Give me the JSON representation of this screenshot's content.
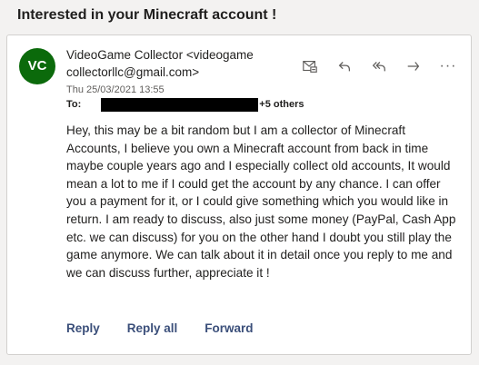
{
  "subject": "Interested in your Minecraft account !",
  "message": {
    "avatar_initials": "VC",
    "avatar_color": "#0b6a0b",
    "sender": "VideoGame Collector <videogame collectorllc@gmail.com>",
    "date": "Thu 25/03/2021 13:55",
    "to_label": "To:",
    "to_others": "+5 others",
    "body": "Hey, this may be a bit random but I am a collector of Minecraft Accounts, I believe you own a Minecraft account from back in time maybe couple years ago and I especially collect old accounts, It would mean a lot to me if I could get the account by any chance. I can offer you a payment for it, or I could give something which you would like in return. I am ready to discuss, also just some money (PayPal, Cash App etc. we can discuss) for you on the other hand I doubt you still play the game anymore. We can talk about it in detail once you reply to me and we can discuss further, appreciate it !"
  },
  "toolbar": {
    "icons": [
      "mail-settings-icon",
      "reply-icon",
      "reply-all-icon",
      "forward-icon",
      "more-icon"
    ],
    "more_glyph": "···"
  },
  "footer": {
    "reply_label": "Reply",
    "reply_all_label": "Reply all",
    "forward_label": "Forward"
  }
}
